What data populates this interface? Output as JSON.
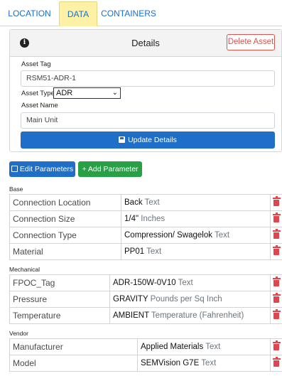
{
  "tabs": [
    {
      "label": "LOCATION"
    },
    {
      "label": "DATA",
      "active": true
    },
    {
      "label": "CONTAINERS"
    }
  ],
  "details": {
    "title": "Details",
    "delete_label": "Delete Asset",
    "asset_tag_label": "Asset Tag",
    "asset_tag_value": "RSM51-ADR-1",
    "asset_type_label": "Asset Type",
    "asset_type_value": "ADR",
    "asset_name_label": "Asset Name",
    "asset_name_value": "Main Unit",
    "update_label": "Update Details"
  },
  "actions": {
    "edit_label": "Edit Parameters",
    "add_label": "+ Add Parameter"
  },
  "sections": [
    {
      "name": "Base",
      "rows": [
        {
          "name": "Connection Location",
          "value": "Back",
          "unit": "Text"
        },
        {
          "name": "Connection Size",
          "value": "1/4\"",
          "unit": "Inches"
        },
        {
          "name": "Connection Type",
          "value": "Compression/ Swagelok",
          "unit": "Text"
        },
        {
          "name": "Material",
          "value": "PP01",
          "unit": "Text"
        }
      ]
    },
    {
      "name": "Mechanical",
      "rows": [
        {
          "name": "FPOC_Tag",
          "value": "ADR-150W-0V10",
          "unit": "Text"
        },
        {
          "name": "Pressure",
          "value": "GRAVITY",
          "unit": "Pounds per Sq Inch"
        },
        {
          "name": "Temperature",
          "value": "AMBIENT",
          "unit": "Temperature (Fahrenheit)"
        }
      ]
    },
    {
      "name": "Vendor",
      "rows": [
        {
          "name": "Manufacturer",
          "value": "Applied Materials",
          "unit": "Text"
        },
        {
          "name": "Model",
          "value": "SEMVision G7E",
          "unit": "Text"
        }
      ]
    }
  ],
  "colors": {
    "primary": "#1f6fc9",
    "success": "#27a046",
    "danger": "#d9534f",
    "active_tab": "#fdf1a6"
  },
  "icons": {
    "info": "info-circle-icon",
    "save": "floppy-disk-icon",
    "edit": "edit-icon",
    "delete_row": "trash-icon"
  }
}
